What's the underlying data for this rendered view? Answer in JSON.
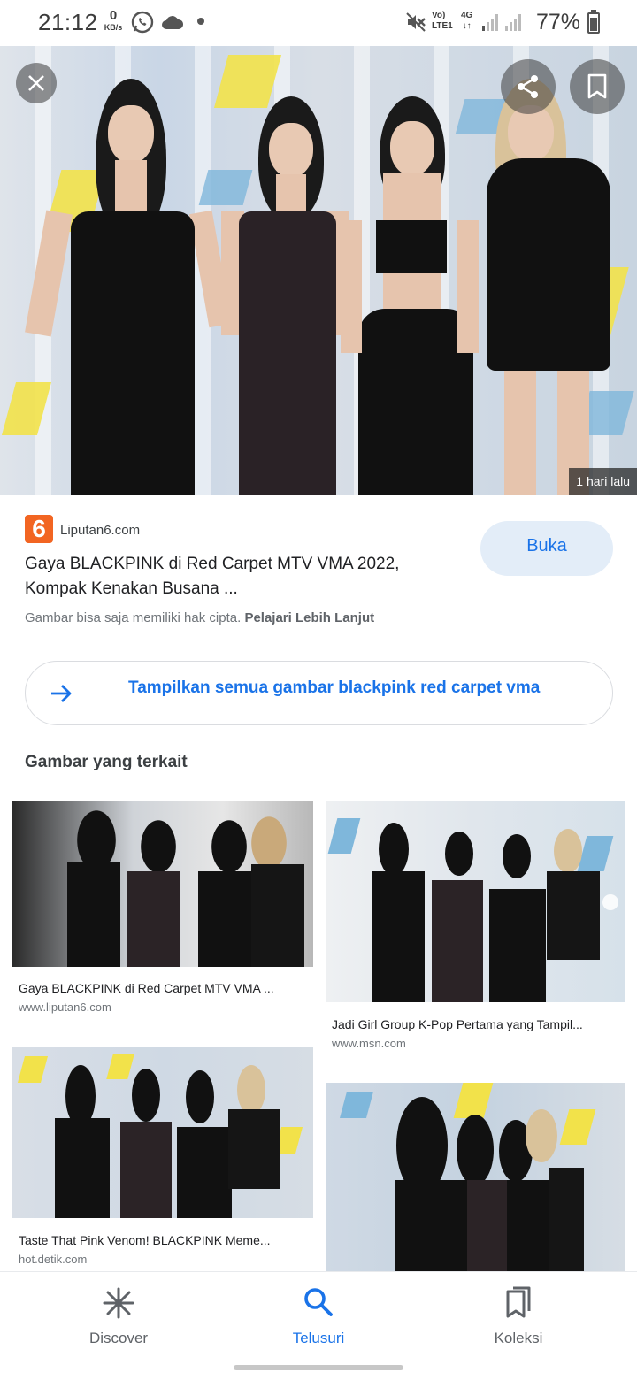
{
  "status_bar": {
    "time": "21:12",
    "net_speed_value": "0",
    "net_speed_unit": "KB/s",
    "volte_line1": "Vo)",
    "volte_line2": "LTE1",
    "network_type": "4G",
    "battery_percent": "77%",
    "battery_level": 0.77
  },
  "hero": {
    "time_badge": "1 hari lalu"
  },
  "result": {
    "source_name": "Liputan6.com",
    "source_logo_text": "6",
    "title_line1": "Gaya BLACKPINK di Red Carpet MTV VMA 2022,",
    "title_line2": "Kompak Kenakan Busana ...",
    "open_button": "Buka",
    "rights_text": "Gambar bisa saja memiliki hak cipta.",
    "rights_link": "Pelajari Lebih Lanjut"
  },
  "show_all": {
    "label": "Tampilkan semua gambar blackpink red carpet vma"
  },
  "related": {
    "heading": "Gambar yang terkait",
    "items": [
      {
        "title": "Gaya BLACKPINK di Red Carpet MTV VMA ...",
        "site": "www.liputan6.com"
      },
      {
        "title": "Jadi Girl Group K-Pop Pertama yang Tampil...",
        "site": "www.msn.com"
      },
      {
        "title": "Taste That Pink Venom! BLACKPINK Meme...",
        "site": "hot.detik.com"
      },
      {
        "title": "",
        "site": ""
      }
    ]
  },
  "bottom_nav": {
    "items": [
      {
        "label": "Discover",
        "icon": "asterisk-icon"
      },
      {
        "label": "Telusuri",
        "icon": "search-icon"
      },
      {
        "label": "Koleksi",
        "icon": "collections-icon"
      }
    ],
    "active_index": 1
  },
  "colors": {
    "accent": "#1a73e8",
    "buka_bg": "#e3edf8",
    "source_logo": "#f26522"
  }
}
